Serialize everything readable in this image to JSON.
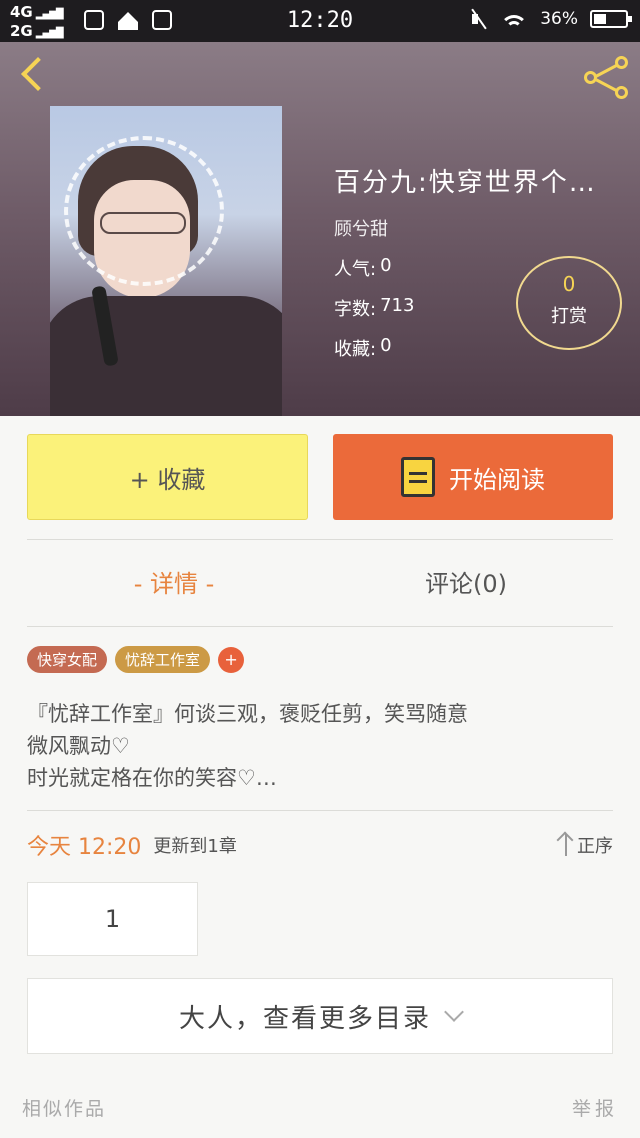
{
  "status_bar": {
    "network1": "4G",
    "network2": "2G",
    "time": "12:20",
    "battery": "36%"
  },
  "header": {
    "icons": {
      "back": "back-arrow-icon",
      "share": "share-icon"
    },
    "title": "百分九:快穿世界个…",
    "author": "顾兮甜",
    "popularity_label": "人气:",
    "popularity": "0",
    "words_label": "字数:",
    "words": "713",
    "collections_label": "收藏:",
    "collections": "0",
    "tip_count": "0",
    "tip_label": "打赏"
  },
  "actions": {
    "favorite_label": "+ 收藏",
    "read_label": "开始阅读"
  },
  "tabs": {
    "details": "- 详情 -",
    "comments": "评论(0)"
  },
  "tags": [
    {
      "label": "快穿女配",
      "color": "#c46a52"
    },
    {
      "label": "忧辞工作室",
      "color": "#cc9a45"
    }
  ],
  "tag_add_label": "+",
  "description": {
    "line1": "『忧辞工作室』何谈三观，褒贬任剪，笑骂随意",
    "line2": "微风飘动♡",
    "line3": "时光就定格在你的笑容♡…"
  },
  "update": {
    "date": "今天 12:20",
    "text": "更新到1章",
    "sort_label": "正序"
  },
  "chapters": {
    "first": "1"
  },
  "more_catalog": "大人，查看更多目录",
  "footer": {
    "similar": "相似作品",
    "report": "举报"
  },
  "colors": {
    "accent": "#eb6a3a",
    "favorite_bg": "#fbf27a",
    "highlight_text": "#e7843f",
    "icon_yellow": "#f6d455"
  }
}
